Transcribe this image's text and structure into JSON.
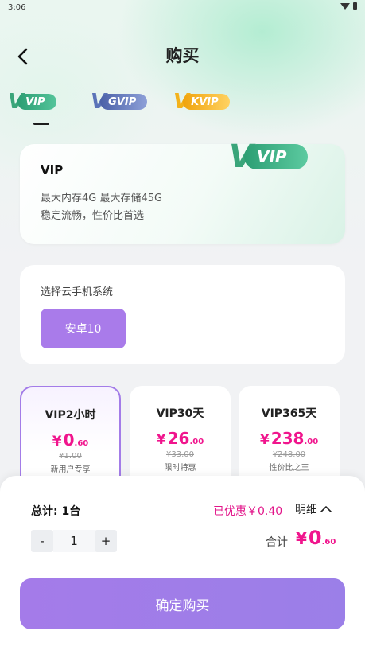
{
  "status_bar": {
    "time": "3:06"
  },
  "header": {
    "title": "购买"
  },
  "tiers": [
    {
      "mark": "V",
      "label": "VIP"
    },
    {
      "mark": "V",
      "label": "GVIP"
    },
    {
      "mark": "V",
      "label": "KVIP"
    }
  ],
  "info_card": {
    "title": "VIP",
    "line1": "最大内存4G 最大存储45G",
    "line2": "稳定流畅，性价比首选",
    "badge": "VIP"
  },
  "os_section": {
    "label": "选择云手机系统",
    "option": "安卓10"
  },
  "plans": [
    {
      "name": "VIP2小时",
      "yen": "¥",
      "int": "0",
      "dec": ".60",
      "orig": "¥1.00",
      "tag": "新用户专享"
    },
    {
      "name": "VIP30天",
      "yen": "¥",
      "int": "26",
      "dec": ".00",
      "orig": "¥33.00",
      "tag": "限时特惠"
    },
    {
      "name": "VIP365天",
      "yen": "¥",
      "int": "238",
      "dec": ".00",
      "orig": "¥248.00",
      "tag": "性价比之王"
    }
  ],
  "summary": {
    "total_count": "总计: 1台",
    "discount": "已优惠￥0.40",
    "detail": "明细",
    "minus": "-",
    "quantity": "1",
    "plus": "+",
    "sum_label": "合计",
    "sum_yen": "¥",
    "sum_int": "0",
    "sum_dec": ".60"
  },
  "confirm_label": "确定购买",
  "colors": {
    "accent": "#a97bea",
    "price": "#f0158d",
    "vip_green": "#2c9e73",
    "gvip_blue": "#4b61a8",
    "kvip_gold": "#f0a30d"
  }
}
